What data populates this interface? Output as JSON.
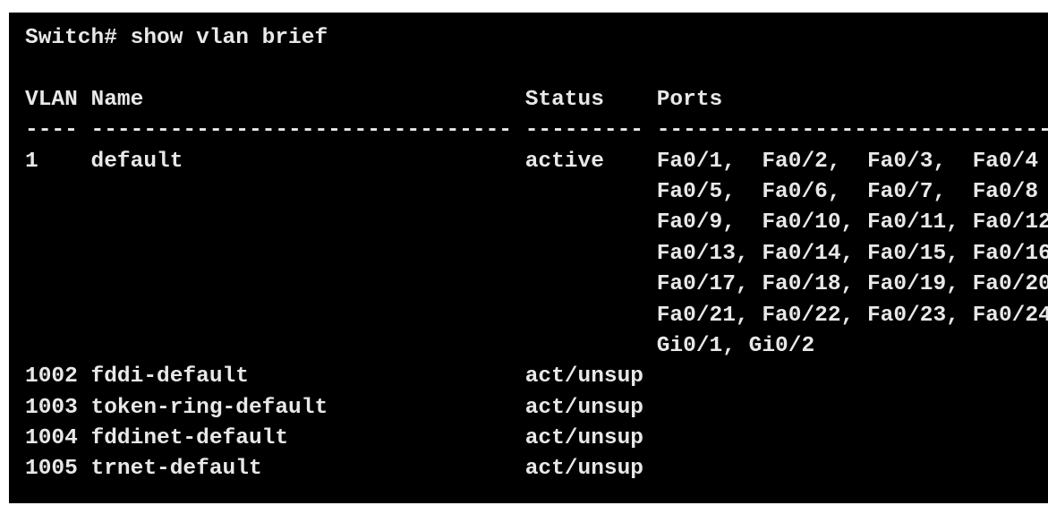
{
  "terminal": {
    "prompt_command": "Switch# show vlan brief",
    "blank": "",
    "header": "VLAN Name                             Status    Ports",
    "separator": "---- -------------------------------- --------- -------------------------------",
    "rows": [
      "1    default                          active    Fa0/1,  Fa0/2,  Fa0/3,  Fa0/4",
      "                                                Fa0/5,  Fa0/6,  Fa0/7,  Fa0/8",
      "                                                Fa0/9,  Fa0/10, Fa0/11, Fa0/12",
      "                                                Fa0/13, Fa0/14, Fa0/15, Fa0/16",
      "                                                Fa0/17, Fa0/18, Fa0/19, Fa0/20",
      "                                                Fa0/21, Fa0/22, Fa0/23, Fa0/24",
      "                                                Gi0/1, Gi0/2",
      "1002 fddi-default                     act/unsup",
      "1003 token-ring-default               act/unsup",
      "1004 fddinet-default                  act/unsup",
      "1005 trnet-default                    act/unsup"
    ]
  },
  "colors": {
    "background": "#000000",
    "text": "#e8e8e8"
  }
}
